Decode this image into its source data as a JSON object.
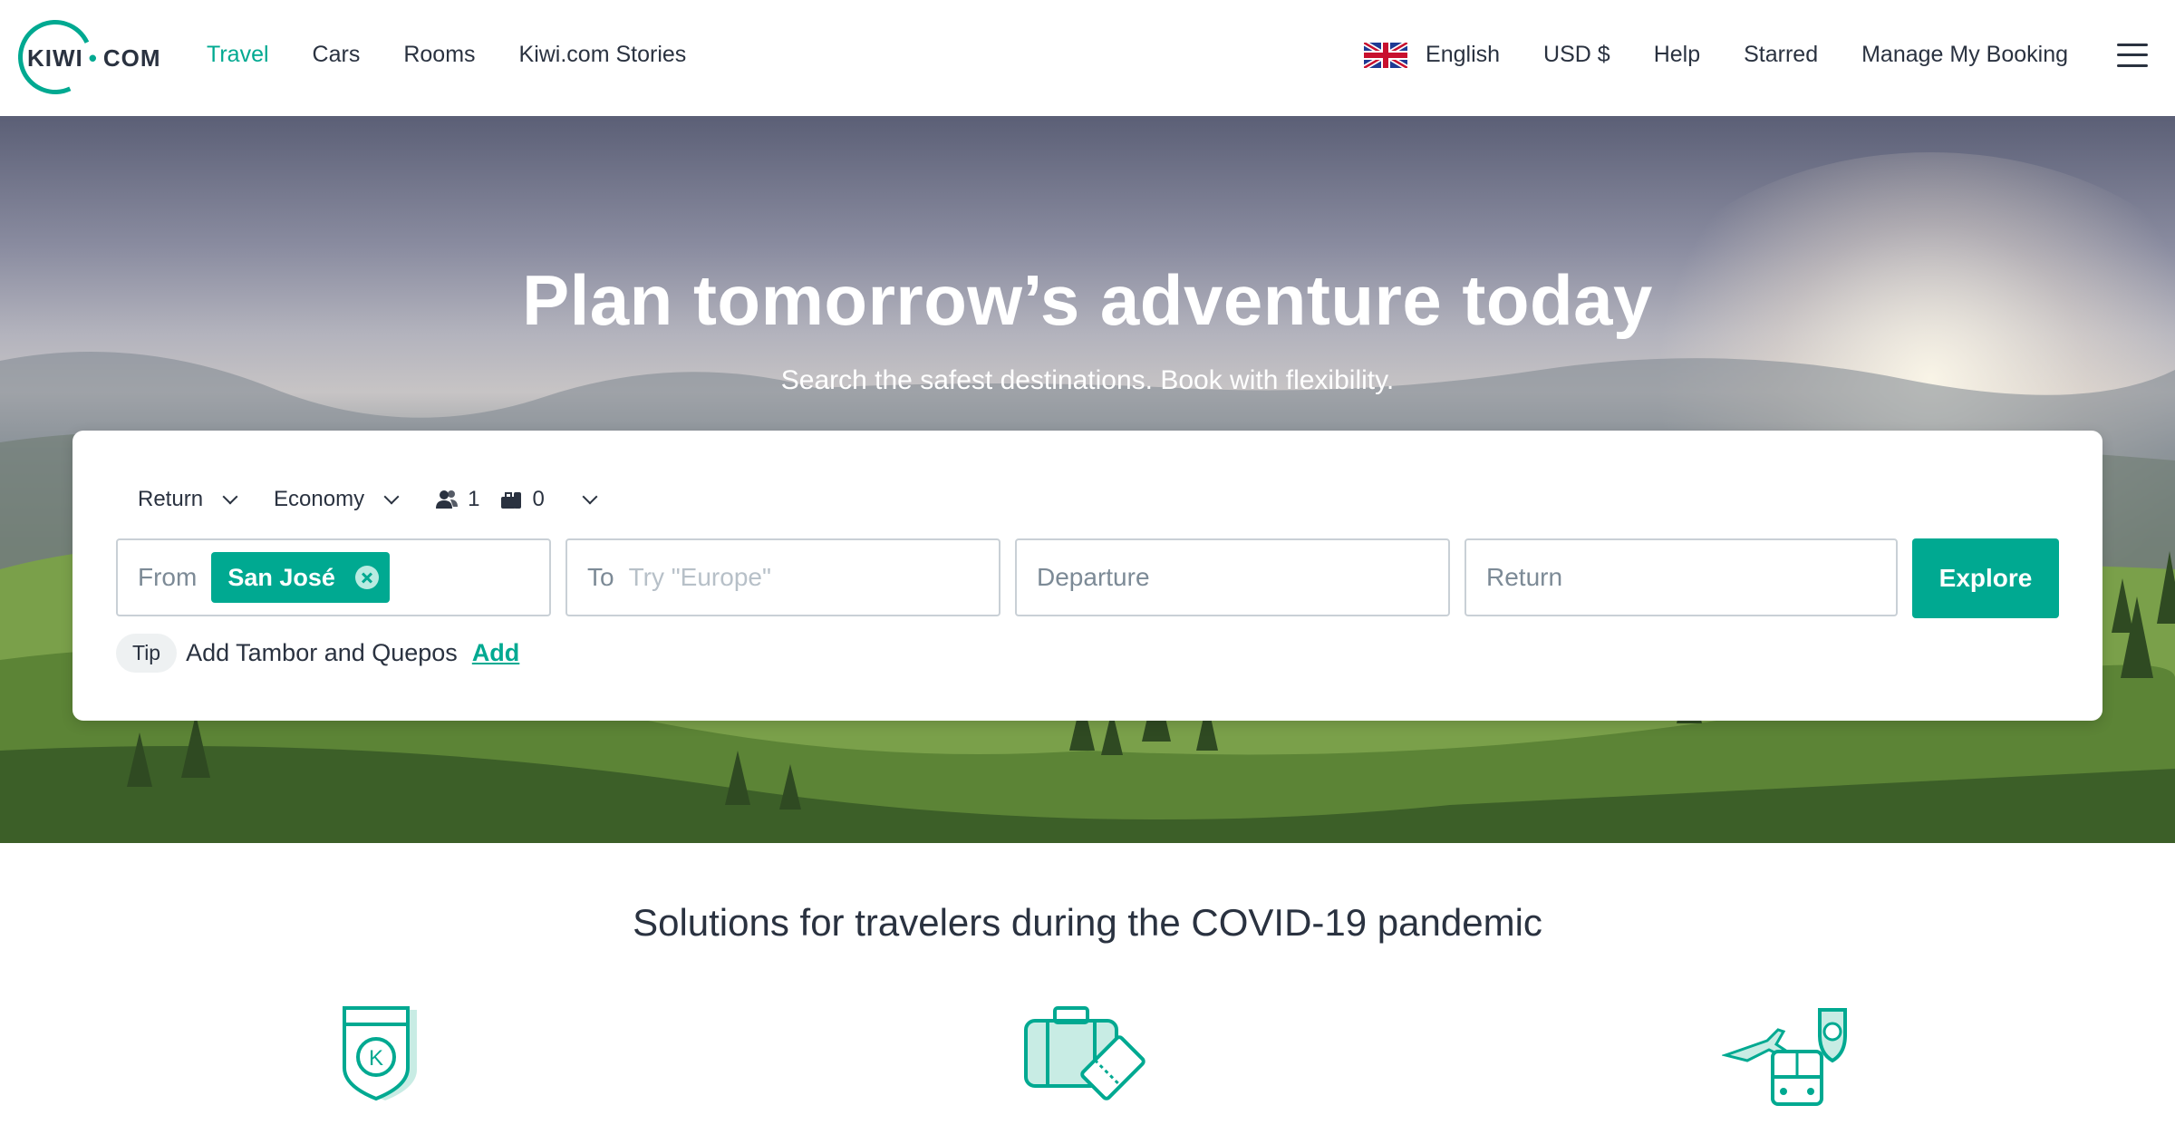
{
  "logo": {
    "text_left": "KIWI",
    "text_right": "COM"
  },
  "nav": {
    "links": [
      {
        "label": "Travel",
        "active": true
      },
      {
        "label": "Cars"
      },
      {
        "label": "Rooms"
      },
      {
        "label": "Kiwi.com Stories"
      }
    ],
    "language": "English",
    "currency": "USD $",
    "help": "Help",
    "starred": "Starred",
    "manage": "Manage My Booking"
  },
  "hero": {
    "title": "Plan tomorrow’s adventure today",
    "subtitle": "Search the safest destinations. Book with flexibility."
  },
  "search": {
    "trip_type": "Return",
    "cabin_class": "Economy",
    "passengers": "1",
    "bags": "0",
    "from_label": "From",
    "from_value": "San José",
    "to_label": "To",
    "to_placeholder": "Try \"Europe\"",
    "departure_placeholder": "Departure",
    "return_placeholder": "Return",
    "explore_label": "Explore",
    "tip_badge": "Tip",
    "tip_text": "Add Tambor and Quepos",
    "tip_action": "Add"
  },
  "solutions": {
    "title": "Solutions for travelers during the COVID-19 pandemic",
    "icons": [
      "kiwi-guarantee-shield-icon",
      "luggage-ticket-icon",
      "multimodal-transport-icon"
    ]
  },
  "colors": {
    "accent": "#00a991",
    "text": "#2a3240"
  }
}
